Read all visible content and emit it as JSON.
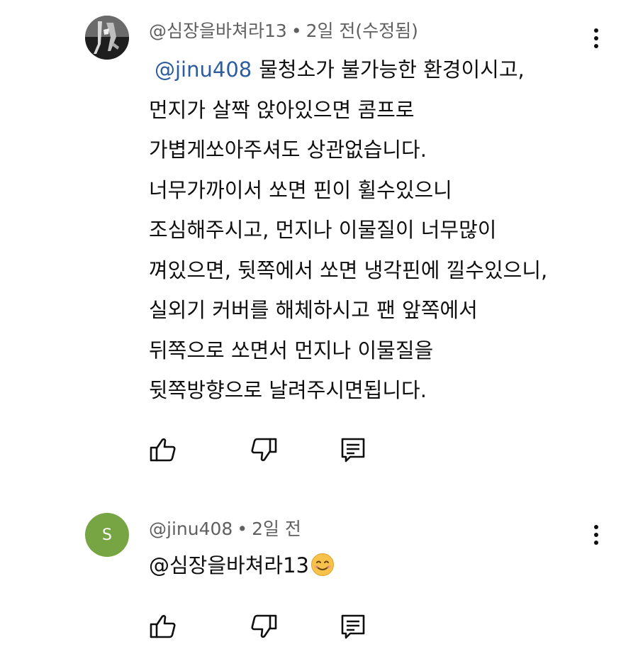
{
  "comments": [
    {
      "author": "@심장을바쳐라13",
      "separator": "•",
      "time": "2일 전(수정됨)",
      "avatar": {
        "type": "photo",
        "color": "#2b2b2b"
      },
      "mention": "@jinu408",
      "lines": [
        "물청소가 불가능한 환경이시고,",
        "먼지가 살짝 앉아있으면 콤프로",
        "가볍게쏘아주셔도 상관없습니다.",
        "너무가까이서 쏘면 핀이 휠수있으니",
        "조심해주시고, 먼지나 이물질이 너무많이",
        "껴있으면, 뒷쪽에서 쏘면 냉각핀에 낄수있으니,",
        "실외기 커버를 해체하시고 팬 앞쪽에서",
        "뒤쪽으로  쏘면서 먼지나 이물질을",
        "뒷쪽방향으로 날려주시면됩니다."
      ],
      "actions": {
        "like": "thumbs-up-icon",
        "dislike": "thumbs-down-icon",
        "reply": "comment-reply-icon"
      }
    },
    {
      "author": "@jinu408",
      "separator": "•",
      "time": "2일 전",
      "avatar": {
        "type": "letter",
        "letter": "S",
        "color": "#78a544"
      },
      "text": "@심장을바쳐라13",
      "emoji": "smiling-face-emoji",
      "actions": {
        "like": "thumbs-up-icon",
        "dislike": "thumbs-down-icon",
        "reply": "comment-reply-icon"
      }
    }
  ],
  "colors": {
    "text": "#0f0f0f",
    "meta": "#606060",
    "mention": "#2d5c9f"
  }
}
